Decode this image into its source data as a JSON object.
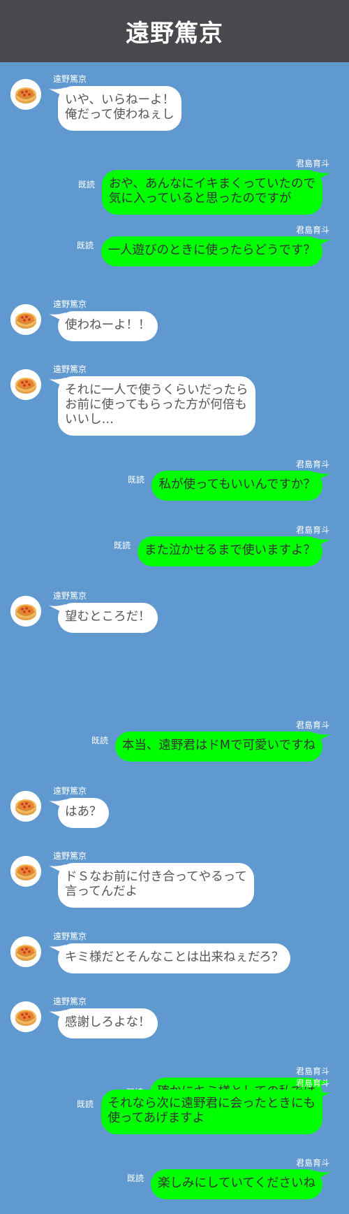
{
  "header": {
    "title": "遠野篤京"
  },
  "participants": {
    "left_name": "遠野篤京",
    "right_name": "君島育斗",
    "avatar_icon": "pie-icon"
  },
  "read_label": "既読",
  "colors": {
    "header_bg": "#48484d",
    "chat_bg": "#5f99cf",
    "incoming_bubble": "#ffffff",
    "outgoing_bubble": "#00ff00"
  },
  "messages": [
    {
      "side": "in",
      "text": "いや、いらねーよ！\n俺だって使わねぇし"
    },
    {
      "side": "out",
      "text": "おや、あんなにイキまくっていたので\n気に入っていると思ったのですが",
      "read": true
    },
    {
      "side": "out",
      "text": "一人遊びのときに使ったらどうです？",
      "read": true
    },
    {
      "side": "in",
      "text": "使わねーよ！！"
    },
    {
      "side": "in",
      "text": "それに一人で使うくらいだったら\nお前に使ってもらった方が何倍も\nいいし…"
    },
    {
      "side": "out",
      "text": "私が使ってもいいんですか？",
      "read": true
    },
    {
      "side": "out",
      "text": "また泣かせるまで使いますよ？",
      "read": true
    },
    {
      "side": "in",
      "text": "望むところだ！"
    },
    {
      "side": "out",
      "text": "本当、遠野君はドMで可愛いですね",
      "read": true
    },
    {
      "side": "in",
      "text": "はあ？"
    },
    {
      "side": "in",
      "text": "ドＳなお前に付き合ってやるって\n言ってんだよ"
    },
    {
      "side": "in",
      "text": "キミ様だとそんなことは出来ねぇだろ？"
    },
    {
      "side": "in",
      "text": "感謝しろよな！"
    },
    {
      "side": "out",
      "text": "確かにキミ様としての私では\n考えられませんね",
      "read": true
    },
    {
      "side": "out",
      "text": "それなら次に遠野君に会ったときにも\n使ってあげますよ",
      "read": true
    },
    {
      "side": "out",
      "text": "楽しみにしていてくださいね",
      "read": true
    }
  ]
}
